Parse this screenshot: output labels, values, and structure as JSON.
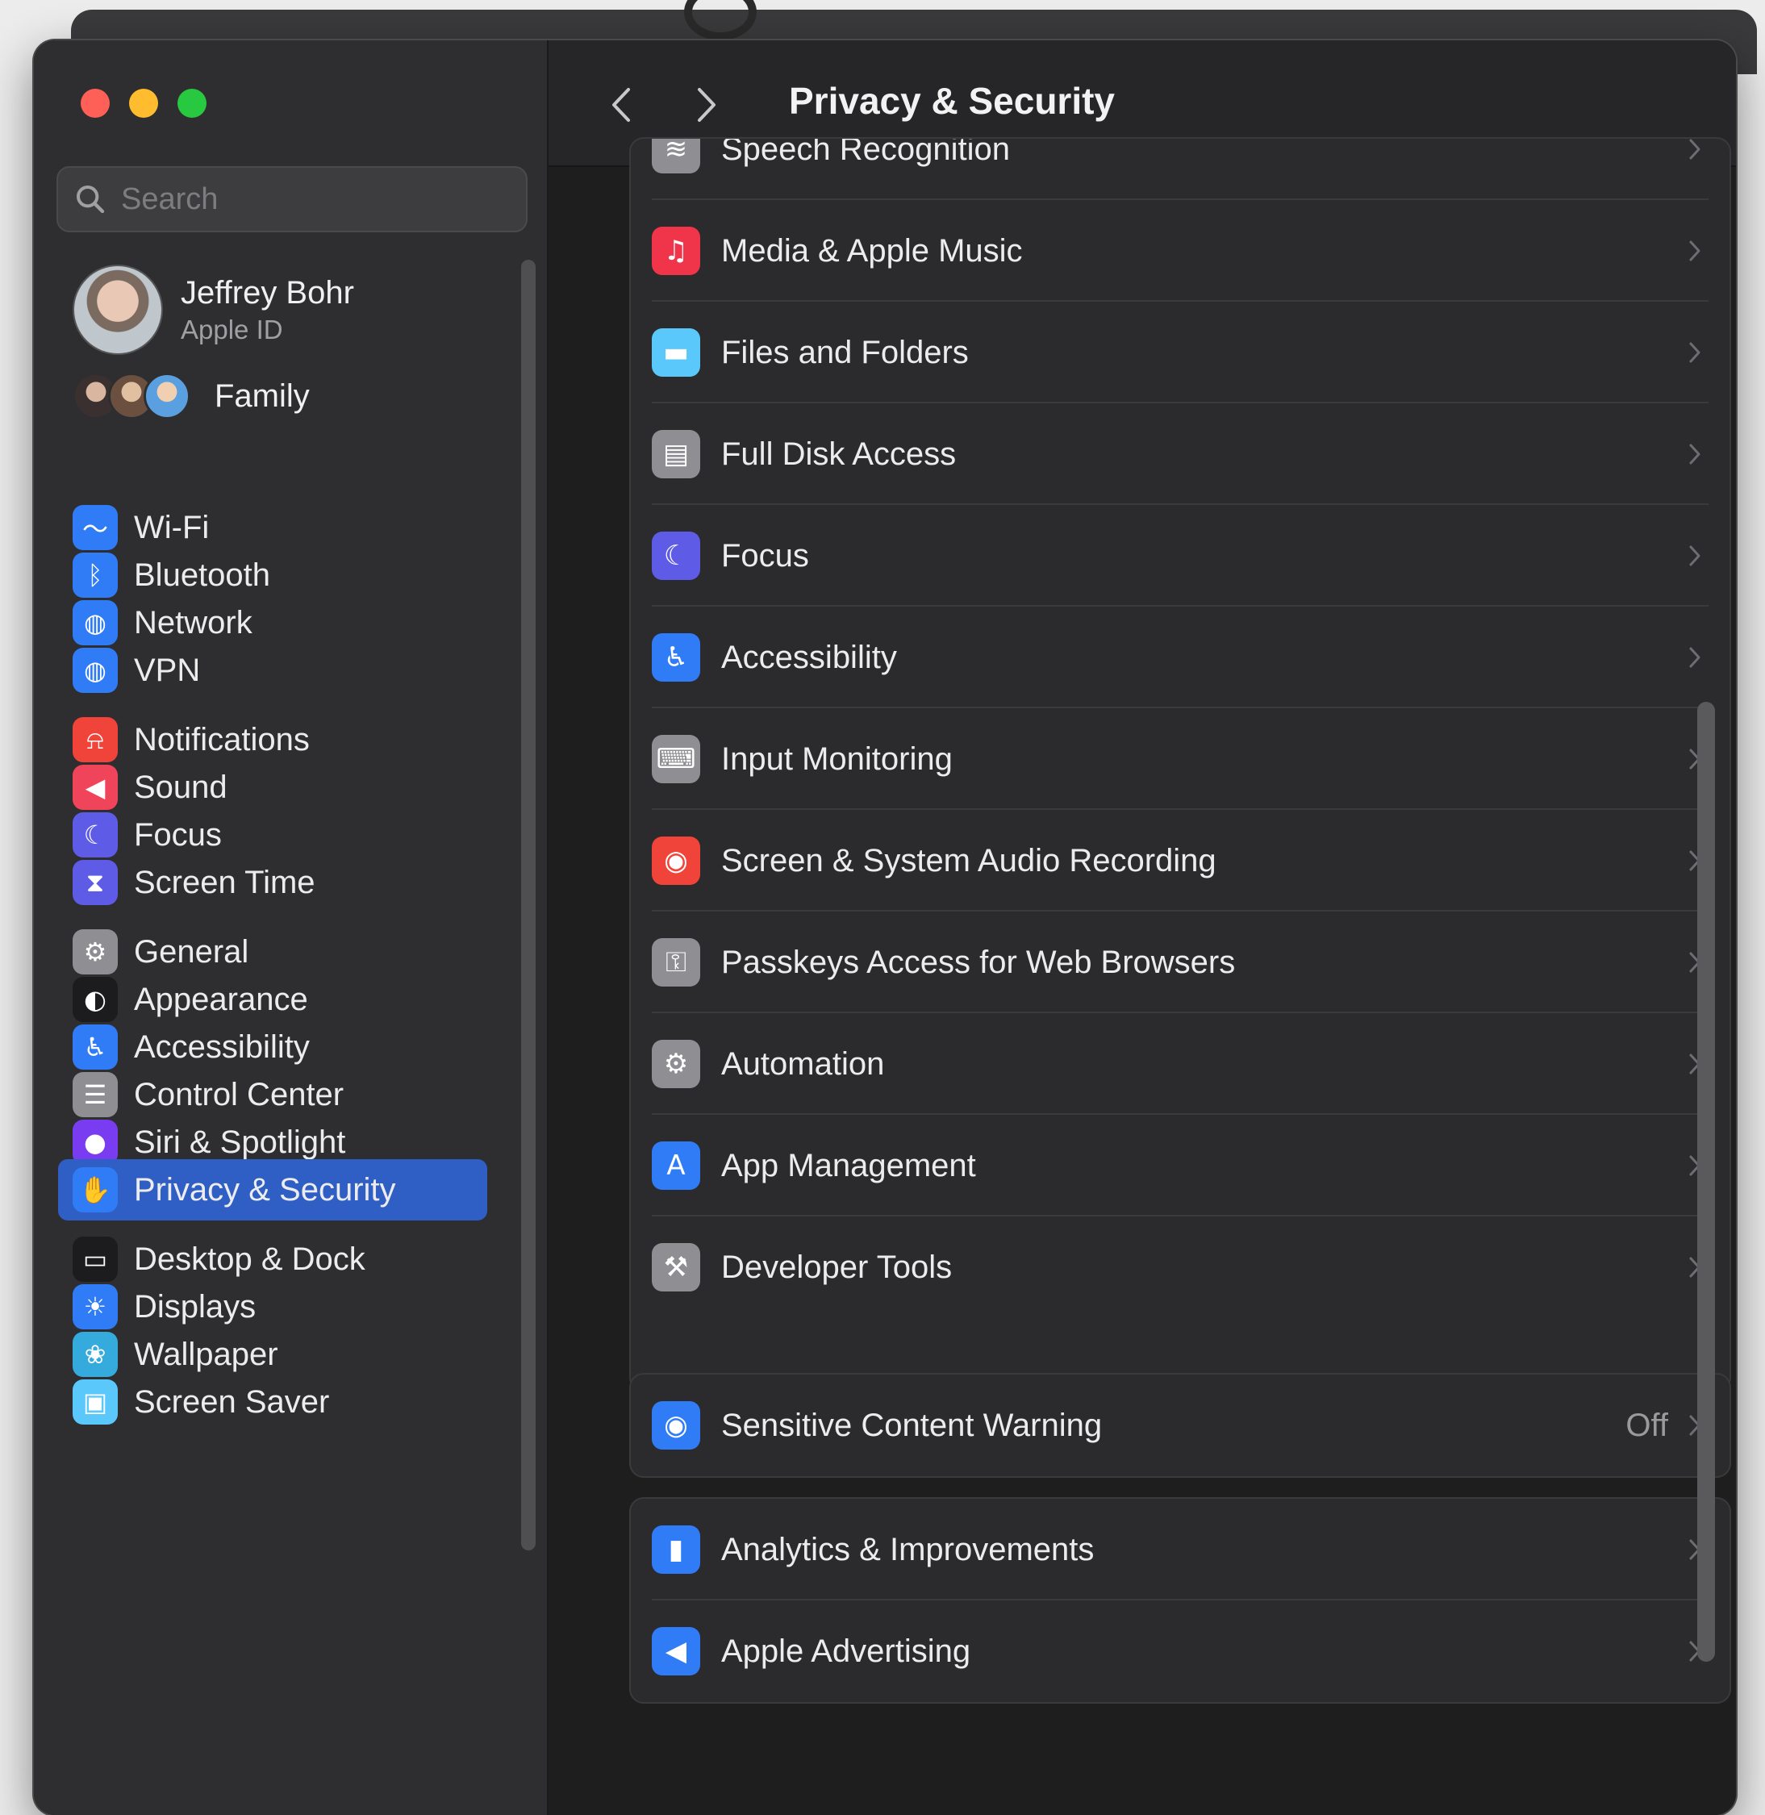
{
  "window": {
    "traffic_lights": [
      "close",
      "minimize",
      "zoom"
    ]
  },
  "sidebar": {
    "search_placeholder": "Search",
    "profile": {
      "name": "Jeffrey Bohr",
      "subtitle": "Apple ID"
    },
    "family": {
      "label": "Family"
    },
    "items": [
      {
        "label": "Wi-Fi",
        "icon": "wifi-icon",
        "color": "#2f7cf6"
      },
      {
        "label": "Bluetooth",
        "icon": "bluetooth-icon",
        "color": "#2f7cf6"
      },
      {
        "label": "Network",
        "icon": "globe-icon",
        "color": "#2f7cf6"
      },
      {
        "label": "VPN",
        "icon": "vpn-globe-icon",
        "color": "#2f7cf6"
      },
      {
        "label": "Notifications",
        "icon": "bell-icon",
        "color": "#f0443a"
      },
      {
        "label": "Sound",
        "icon": "speaker-icon",
        "color": "#f0445a"
      },
      {
        "label": "Focus",
        "icon": "moon-icon",
        "color": "#5e5ce6"
      },
      {
        "label": "Screen Time",
        "icon": "hourglass-icon",
        "color": "#5e5ce6"
      },
      {
        "label": "General",
        "icon": "gear-icon",
        "color": "#8e8e93"
      },
      {
        "label": "Appearance",
        "icon": "appearance-icon",
        "color": "#1c1c1e"
      },
      {
        "label": "Accessibility",
        "icon": "accessibility-icon",
        "color": "#2f7cf6"
      },
      {
        "label": "Control Center",
        "icon": "control-center-icon",
        "color": "#8e8e93"
      },
      {
        "label": "Siri & Spotlight",
        "icon": "siri-icon",
        "color": "#7a3cf0"
      },
      {
        "label": "Privacy & Security",
        "icon": "hand-icon",
        "color": "#2f7cf6",
        "selected": true
      },
      {
        "label": "Desktop & Dock",
        "icon": "dock-icon",
        "color": "#1c1c1e"
      },
      {
        "label": "Displays",
        "icon": "sun-icon",
        "color": "#2f7cf6"
      },
      {
        "label": "Wallpaper",
        "icon": "wallpaper-icon",
        "color": "#35aadc"
      },
      {
        "label": "Screen Saver",
        "icon": "screen-saver-icon",
        "color": "#5ac8fa"
      }
    ]
  },
  "toolbar": {
    "title": "Privacy & Security",
    "back_icon": "chevron-left-icon",
    "forward_icon": "chevron-right-icon"
  },
  "main": {
    "group1": [
      {
        "label": "Speech Recognition",
        "icon": "waveform-icon",
        "color": "#8e8e93"
      },
      {
        "label": "Media & Apple Music",
        "icon": "music-note-icon",
        "color": "#f0344a"
      },
      {
        "label": "Files and Folders",
        "icon": "folder-icon",
        "color": "#5ac8fa"
      },
      {
        "label": "Full Disk Access",
        "icon": "disk-icon",
        "color": "#8e8e93"
      },
      {
        "label": "Focus",
        "icon": "moon-icon",
        "color": "#5e5ce6"
      },
      {
        "label": "Accessibility",
        "icon": "accessibility-icon",
        "color": "#2f7cf6"
      },
      {
        "label": "Input Monitoring",
        "icon": "keyboard-icon",
        "color": "#8e8e93"
      },
      {
        "label": "Screen & System Audio Recording",
        "icon": "record-icon",
        "color": "#f0443a"
      },
      {
        "label": "Passkeys Access for Web Browsers",
        "icon": "passkey-icon",
        "color": "#8e8e93"
      },
      {
        "label": "Automation",
        "icon": "gears-icon",
        "color": "#8e8e93"
      },
      {
        "label": "App Management",
        "icon": "app-store-icon",
        "color": "#2f7cf6"
      },
      {
        "label": "Developer Tools",
        "icon": "hammer-icon",
        "color": "#8e8e93"
      }
    ],
    "group2": [
      {
        "label": "Sensitive Content Warning",
        "value": "Off",
        "icon": "eye-icon",
        "color": "#2f7cf6"
      }
    ],
    "group3": [
      {
        "label": "Analytics & Improvements",
        "icon": "bar-chart-icon",
        "color": "#2f7cf6"
      },
      {
        "label": "Apple Advertising",
        "icon": "megaphone-icon",
        "color": "#2f7cf6"
      }
    ]
  }
}
